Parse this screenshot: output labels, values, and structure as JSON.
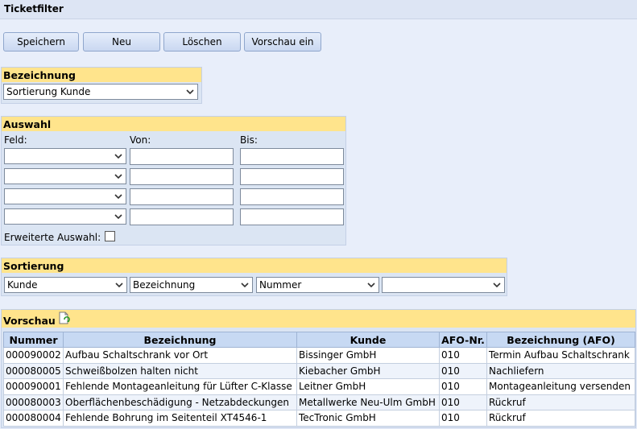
{
  "window": {
    "title": "Ticketfilter"
  },
  "toolbar": {
    "save": "Speichern",
    "new": "Neu",
    "delete": "Löschen",
    "preview": "Vorschau ein"
  },
  "bezeichnung": {
    "heading": "Bezeichnung",
    "selected": "Sortierung Kunde"
  },
  "auswahl": {
    "heading": "Auswahl",
    "col_feld": "Feld:",
    "col_von": "Von:",
    "col_bis": "Bis:",
    "rows": [
      {
        "feld": "",
        "von": "",
        "bis": ""
      },
      {
        "feld": "",
        "von": "",
        "bis": ""
      },
      {
        "feld": "",
        "von": "",
        "bis": ""
      },
      {
        "feld": "",
        "von": "",
        "bis": ""
      }
    ],
    "extended_label": "Erweiterte Auswahl:",
    "extended_checked": false
  },
  "sortierung": {
    "heading": "Sortierung",
    "fields": [
      "Kunde",
      "Bezeichnung",
      "Nummer",
      ""
    ]
  },
  "vorschau": {
    "heading": "Vorschau",
    "refresh_icon": "refresh-document-icon",
    "columns": [
      "Nummer",
      "Bezeichnung",
      "Kunde",
      "AFO-Nr.",
      "Bezeichnung (AFO)"
    ],
    "rows": [
      [
        "000090002",
        "Aufbau Schaltschrank vor Ort",
        "Bissinger GmbH",
        "010",
        "Termin Aufbau Schaltschrank"
      ],
      [
        "000080005",
        "Schweißbolzen halten nicht",
        "Kiebacher GmbH",
        "010",
        "Nachliefern"
      ],
      [
        "000090001",
        "Fehlende Montageanleitung für Lüfter C-Klasse",
        "Leitner GmbH",
        "010",
        "Montageanleitung versenden"
      ],
      [
        "000080003",
        "Oberflächenbeschädigung - Netzabdeckungen",
        "Metallwerke Neu-Ulm GmbH",
        "010",
        "Rückruf"
      ],
      [
        "000080004",
        "Fehlende Bohrung im Seitenteil XT4546-1",
        "TecTronic GmbH",
        "010",
        "Rückruf"
      ]
    ]
  },
  "colors": {
    "header_yellow": "#ffe48c",
    "panel_blue": "#dbe5f3",
    "table_header": "#c7d9f3",
    "page_bg": "#e8eefa"
  }
}
